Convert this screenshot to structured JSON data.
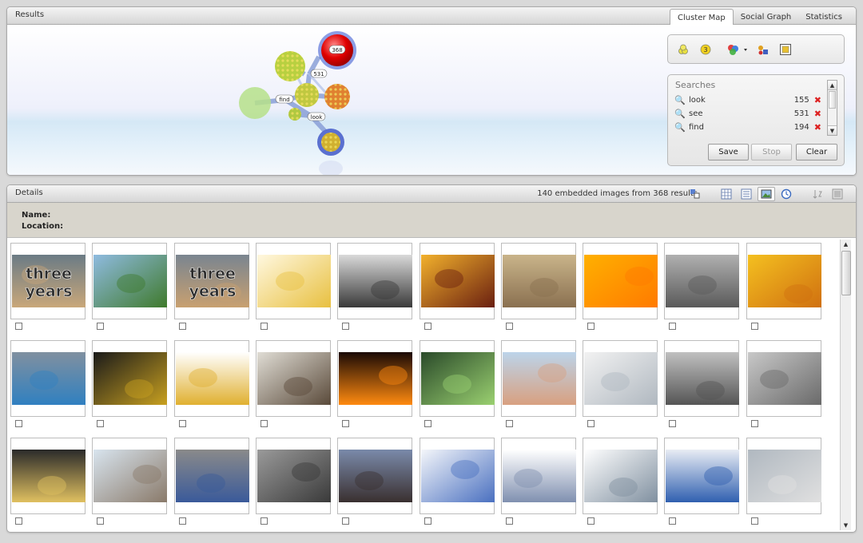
{
  "results": {
    "title": "Results",
    "tabs": [
      {
        "label": "Cluster Map",
        "active": true
      },
      {
        "label": "Social Graph",
        "active": false
      },
      {
        "label": "Statistics",
        "active": false
      }
    ],
    "cluster_labels": {
      "top_count": "368",
      "see": "531",
      "find": "find",
      "look": "look"
    },
    "toolbar_icons": [
      "cluster-overlap-icon",
      "cluster-count-icon",
      "color-palette-icon",
      "shapes-icon",
      "fit-view-icon"
    ],
    "searches": {
      "title": "Searches",
      "items": [
        {
          "term": "look",
          "count": "155"
        },
        {
          "term": "see",
          "count": "531"
        },
        {
          "term": "find",
          "count": "194"
        }
      ]
    },
    "buttons": {
      "save": "Save",
      "stop": "Stop",
      "clear": "Clear"
    }
  },
  "details": {
    "title": "Details",
    "status": "140 embedded images from 368 results",
    "name_label": "Name:",
    "location_label": "Location:",
    "view_icons": [
      "export-icon",
      "grid-view-icon",
      "list-view-icon",
      "image-view-icon",
      "timeline-view-icon",
      "sort-icon",
      "settings-icon"
    ]
  },
  "thumbnails": [
    {
      "name": "three-years-1",
      "text": "three years",
      "c1": "#6b7b85",
      "c2": "#c9a77a"
    },
    {
      "name": "landscape-trees",
      "c1": "#8fbbe0",
      "c2": "#3f7a2c"
    },
    {
      "name": "three-years-2",
      "text": "three years",
      "c1": "#7a8590",
      "c2": "#c8a070"
    },
    {
      "name": "cartoon-bird",
      "c1": "#fff8e0",
      "c2": "#e8c040"
    },
    {
      "name": "window-scene",
      "c1": "#d9d9d9",
      "c2": "#3a3a3a"
    },
    {
      "name": "sunset-tree",
      "c1": "#f2b12c",
      "c2": "#6a1f10"
    },
    {
      "name": "cardboard-boxes",
      "c1": "#c9b48a",
      "c2": "#8a7050"
    },
    {
      "name": "yellow-flower",
      "c1": "#ffb000",
      "c2": "#ff7a00"
    },
    {
      "name": "parked-car",
      "c1": "#b0b0b0",
      "c2": "#5a5a5a"
    },
    {
      "name": "yellow-leaves",
      "c1": "#f4c020",
      "c2": "#d07010"
    },
    {
      "name": "hard-drive",
      "c1": "#8090a0",
      "c2": "#3080c0"
    },
    {
      "name": "glass-dark",
      "c1": "#1a1a1a",
      "c2": "#c8a020"
    },
    {
      "name": "butterfly",
      "c1": "#ffffff",
      "c2": "#e0b030"
    },
    {
      "name": "cat-face",
      "c1": "#e0ddd5",
      "c2": "#5a4a3a"
    },
    {
      "name": "fire-light",
      "c1": "#1a0a05",
      "c2": "#ff8a10"
    },
    {
      "name": "building-grid",
      "c1": "#2a4a2a",
      "c2": "#9ad070"
    },
    {
      "name": "portrait-man",
      "c1": "#bcd4ea",
      "c2": "#d8a080"
    },
    {
      "name": "whiteboard-paper",
      "c1": "#f2f2f2",
      "c2": "#b0b8c0"
    },
    {
      "name": "cage-construction",
      "c1": "#c0c0c0",
      "c2": "#555"
    },
    {
      "name": "metal-frame",
      "c1": "#c8c8c8",
      "c2": "#6a6a6a"
    },
    {
      "name": "dark-mailbox",
      "c1": "#2a2a2a",
      "c2": "#e0c060"
    },
    {
      "name": "mountain-town",
      "c1": "#d8e4ee",
      "c2": "#8a7a6a"
    },
    {
      "name": "man-with-dog",
      "c1": "#8a8a8a",
      "c2": "#3a5a9a"
    },
    {
      "name": "hbo-poster",
      "c1": "#9a9a9a",
      "c2": "#3a3a3a"
    },
    {
      "name": "two-women",
      "c1": "#7a8aaa",
      "c2": "#3a3030"
    },
    {
      "name": "screenshot-window",
      "c1": "#f4f6fa",
      "c2": "#4a70c0"
    },
    {
      "name": "file-list",
      "c1": "#ffffff",
      "c2": "#8090b0"
    },
    {
      "name": "diagram-sheet",
      "c1": "#ffffff",
      "c2": "#8090a0"
    },
    {
      "name": "dialog-form",
      "c1": "#e8ecf4",
      "c2": "#3060b0"
    },
    {
      "name": "street-car",
      "c1": "#b0b8c0",
      "c2": "#e0e0e0"
    }
  ]
}
